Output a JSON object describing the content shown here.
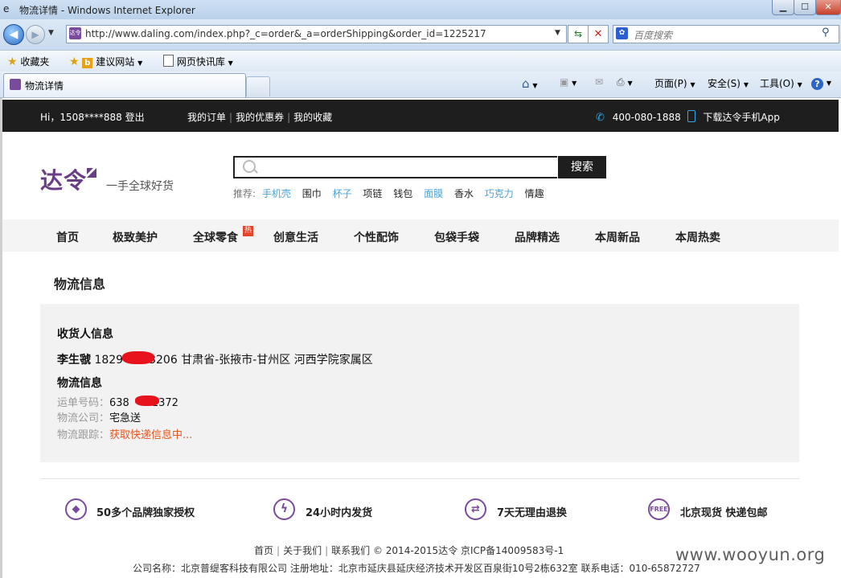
{
  "window": {
    "title": "物流详情 - Windows Internet Explorer",
    "btn_min": "▁",
    "btn_max": "☐",
    "btn_close": "✕"
  },
  "address_bar": {
    "url": "http://www.daling.com/index.php?_c=order&_a=orderShipping&order_id=1225217",
    "search_placeholder": "百度搜索"
  },
  "favorites_bar": {
    "favorites": "收藏夹",
    "suggested_sites": "建议网站",
    "web_slices": "网页快讯库"
  },
  "tabs": {
    "active_title": "物流详情"
  },
  "command_bar": {
    "page": "页面(P)",
    "safety": "安全(S)",
    "tools": "工具(O)"
  },
  "site_topbar": {
    "greeting": "Hi，1508****888",
    "logout": "登出",
    "my_orders": "我的订单",
    "my_coupons": "我的优惠券",
    "my_favorites": "我的收藏",
    "phone": "400-080-1888",
    "app_download": "下载达令手机App"
  },
  "header": {
    "logo": "达令",
    "slogan": "一手全球好货",
    "search_button": "搜索",
    "hot_label": "推荐:",
    "hot_words": [
      {
        "text": "手机壳",
        "style": "blue"
      },
      {
        "text": "围巾",
        "style": "dark"
      },
      {
        "text": "杯子",
        "style": "blue"
      },
      {
        "text": "项链",
        "style": "dark"
      },
      {
        "text": "钱包",
        "style": "dark"
      },
      {
        "text": "面膜",
        "style": "blue"
      },
      {
        "text": "香水",
        "style": "dark"
      },
      {
        "text": "巧克力",
        "style": "blue"
      },
      {
        "text": "情趣",
        "style": "dark"
      }
    ]
  },
  "nav": {
    "items": [
      "首页",
      "极致美护",
      "全球零食",
      "创意生活",
      "个性配饰",
      "包袋手袋",
      "品牌精选",
      "本周新品",
      "本周热卖"
    ],
    "hot_badge": "热"
  },
  "main": {
    "section_title": "物流信息",
    "receiver_heading": "收货人信息",
    "receiver_name": "李生虢",
    "receiver_phone_prefix": "1829",
    "receiver_phone_suffix": "3206",
    "receiver_address": "甘肃省-张掖市-甘州区 河西学院家属区",
    "logistics_heading": "物流信息",
    "waybill_label": "运单号码：",
    "waybill_prefix": "638",
    "waybill_suffix": "1372",
    "company_label": "物流公司：",
    "company_value": "宅急送",
    "tracking_label": "物流跟踪：",
    "tracking_value": "获取快递信息中..."
  },
  "colors": {
    "brand": "#6a3e86",
    "redaction": "#e8121c",
    "tracking_orange": "#e8561c",
    "hot_blue": "#48a3d7"
  },
  "services": [
    {
      "icon": "tag-icon",
      "text": "50多个品牌独家授权"
    },
    {
      "icon": "lightning-icon",
      "text": "24小时内发货"
    },
    {
      "icon": "return-arrows-icon",
      "text": "7天无理由退换"
    },
    {
      "icon": "free-shipping-icon",
      "text": "北京现货 快递包邮",
      "badge": "FREE"
    }
  ],
  "footer": {
    "home": "首页",
    "about": "关于我们",
    "contact": "联系我们",
    "copyright": "© 2014-2015达令 京ICP备14009583号-1",
    "company_info": "公司名称：北京普缇客科技有限公司 注册地址：北京市延庆县延庆经济技术开发区百泉街10号2栋632室 联系电话：010-65872727"
  },
  "watermark": "www.wooyun.org"
}
